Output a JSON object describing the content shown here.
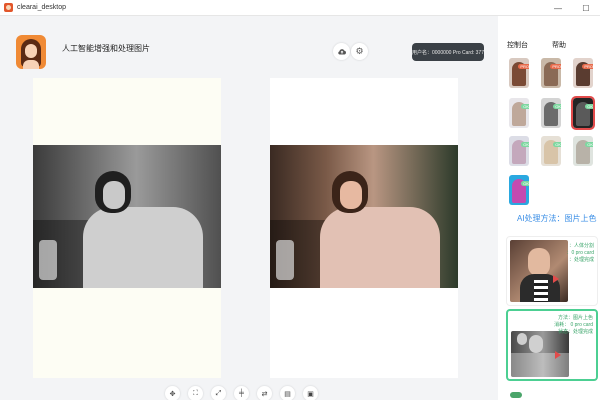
{
  "window": {
    "title": "clearai_desktop",
    "minimize": "—",
    "maximize": "☐"
  },
  "header": {
    "app_title": "人工智能增强和处理图片",
    "user_badge": "用户名：0000000 Pro Card: 377",
    "cloud_icon": "cloud-upload-icon",
    "settings_icon": "gear-icon"
  },
  "toolbar": {
    "tools": [
      {
        "icon": "move-icon",
        "glyph": "✥"
      },
      {
        "icon": "crop-icon",
        "glyph": "⛶"
      },
      {
        "icon": "fit-screen-icon",
        "glyph": "⤢"
      },
      {
        "icon": "align-center-icon",
        "glyph": "╪"
      },
      {
        "icon": "swap-icon",
        "glyph": "⇄"
      },
      {
        "icon": "document-icon",
        "glyph": "▤"
      },
      {
        "icon": "image-icon",
        "glyph": "▣"
      }
    ]
  },
  "sidebar": {
    "tabs": [
      {
        "label": "控制台"
      },
      {
        "label": "帮助"
      }
    ],
    "templates": [
      {
        "badge": "PRO",
        "bg": "#d8c9c0",
        "fg": "#7a4a35",
        "tag": "#e76a4a",
        "selected": false
      },
      {
        "badge": "PRO",
        "bg": "#c9b9a8",
        "fg": "#8a6a55",
        "tag": "#e76a4a",
        "selected": false
      },
      {
        "badge": "PRO",
        "bg": "#e2d3cc",
        "fg": "#5a3c30",
        "tag": "#e76a4a",
        "selected": false
      },
      {
        "badge": "OK",
        "bg": "#e8e6ea",
        "fg": "#bfa89a",
        "tag": "#7dd8a0",
        "selected": false
      },
      {
        "badge": "OK",
        "bg": "#d4d4d4",
        "fg": "#6b6b6b",
        "tag": "#7dd8a0",
        "selected": false
      },
      {
        "badge": "OK",
        "bg": "#242424",
        "fg": "#5a5a5a",
        "tag": "#7dd8a0",
        "selected": true
      },
      {
        "badge": "OK",
        "bg": "#dcdde6",
        "fg": "#c4a8bc",
        "tag": "#7dd8a0",
        "selected": false
      },
      {
        "badge": "OK",
        "bg": "#e6e0d6",
        "fg": "#d8c4a8",
        "tag": "#7dd8a0",
        "selected": false
      },
      {
        "badge": "OK",
        "bg": "#dfe4df",
        "fg": "#b8b2a8",
        "tag": "#7dd8a0",
        "selected": false
      },
      {
        "badge": "OK",
        "bg": "#2aa8e0",
        "fg": "#c44ab0",
        "tag": "#7dd8a0",
        "selected": false
      }
    ],
    "method_title": "AI处理方法：图片上色",
    "cards": [
      {
        "lines": [
          "：人体分割",
          "：0 pro card",
          "：处理完成"
        ],
        "color": "#3aa56a"
      },
      {
        "lines": [
          "方法：图片上色",
          "消耗： 0 pro card",
          "状态：处理完成"
        ],
        "color": "#3aa56a"
      }
    ]
  },
  "colors": {
    "accent": "#3a8ee6",
    "success": "#4ccf92",
    "selected_border": "#e24b4b",
    "badge_bg": "#3a4046"
  }
}
